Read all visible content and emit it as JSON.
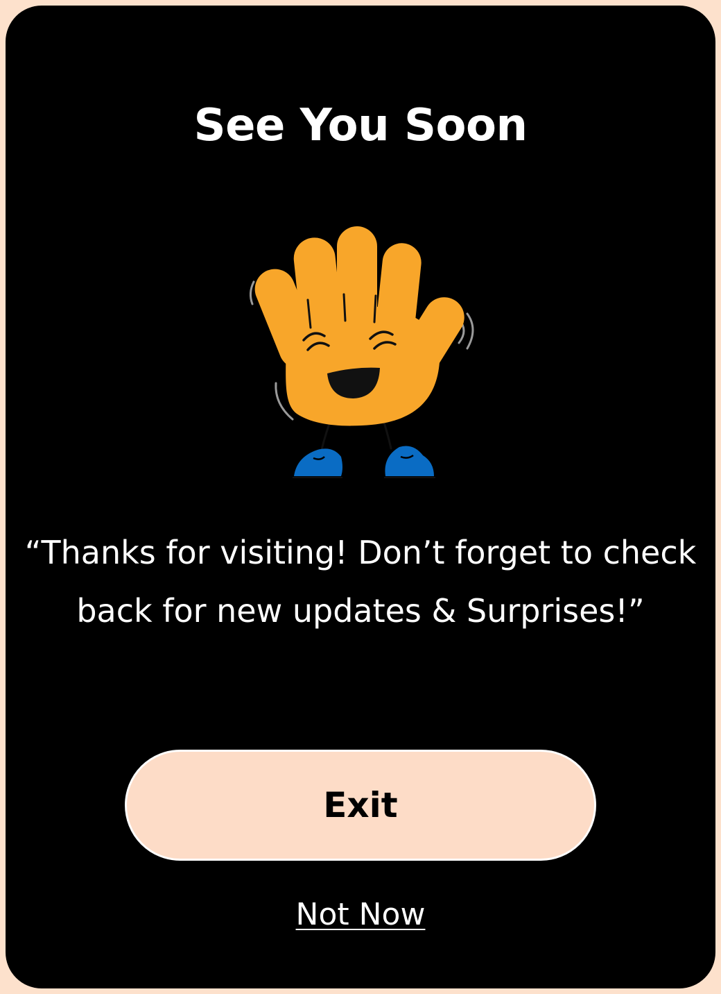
{
  "dialog": {
    "title": "See You Soon",
    "message": "“Thanks for visiting! Don’t forget to check back for new updates & Surprises!”",
    "mascot_icon": "waving-hand-mascot-icon",
    "exit_label": "Exit",
    "not_now_label": "Not Now"
  },
  "colors": {
    "page_background": "#fde1cc",
    "dialog_background": "#000000",
    "exit_button_fill": "#fddcc7",
    "mascot_hand": "#f8a62a",
    "mascot_shoes": "#0a6cc4",
    "text_primary": "#ffffff"
  }
}
